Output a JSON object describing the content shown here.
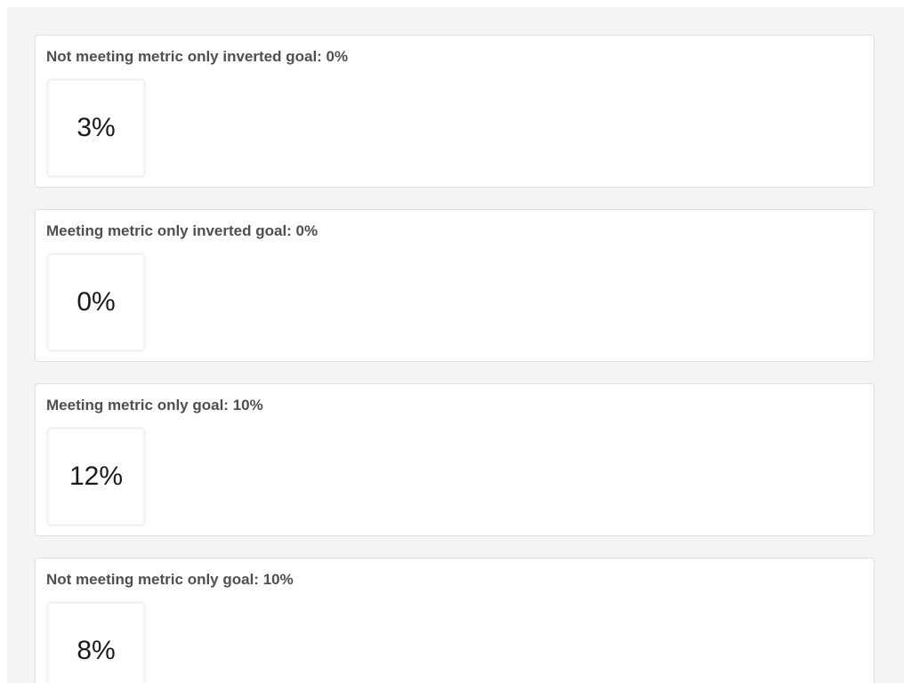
{
  "cards": [
    {
      "title": "Not meeting metric only inverted goal: 0%",
      "value": "3%"
    },
    {
      "title": "Meeting metric only inverted goal: 0%",
      "value": "0%"
    },
    {
      "title": "Meeting metric only goal: 10%",
      "value": "12%"
    },
    {
      "title": "Not meeting metric only goal: 10%",
      "value": "8%"
    }
  ]
}
